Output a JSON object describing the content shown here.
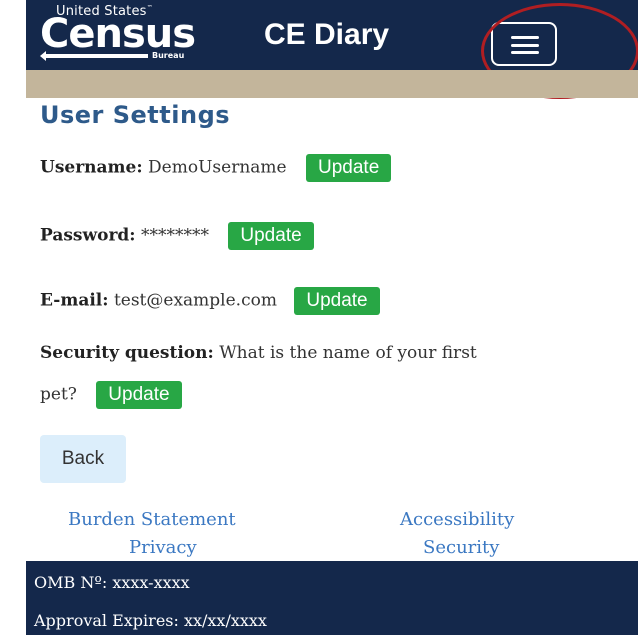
{
  "header": {
    "logo_top": "United States",
    "logo_main": "Census",
    "logo_bureau": "Bureau",
    "app_title": "CE Diary",
    "menu_icon": "hamburger-menu-icon"
  },
  "colors": {
    "header_bg": "#14284b",
    "band": "#c3b59b",
    "title": "#2e5a8a",
    "update_btn": "#28a745",
    "back_btn": "#dceefb",
    "link": "#3b78c2",
    "highlight_ring": "#b01e22"
  },
  "page": {
    "title": "User Settings"
  },
  "settings": {
    "username": {
      "label": "Username:",
      "value": "DemoUsername",
      "button": "Update"
    },
    "password": {
      "label": "Password:",
      "value": "********",
      "button": "Update"
    },
    "email": {
      "label": "E-mail:",
      "value": "test@example.com",
      "button": "Update"
    },
    "security": {
      "label": "Security question:",
      "value_line1": "What is the name of your first",
      "value_line2": "pet?",
      "button": "Update"
    }
  },
  "back_label": "Back",
  "footer_links": {
    "burden": "Burden Statement",
    "privacy": "Privacy",
    "accessibility": "Accessibility",
    "security": "Security"
  },
  "footer": {
    "omb": "OMB Nº: xxxx-xxxx",
    "approval": "Approval Expires: xx/xx/xxxx"
  }
}
